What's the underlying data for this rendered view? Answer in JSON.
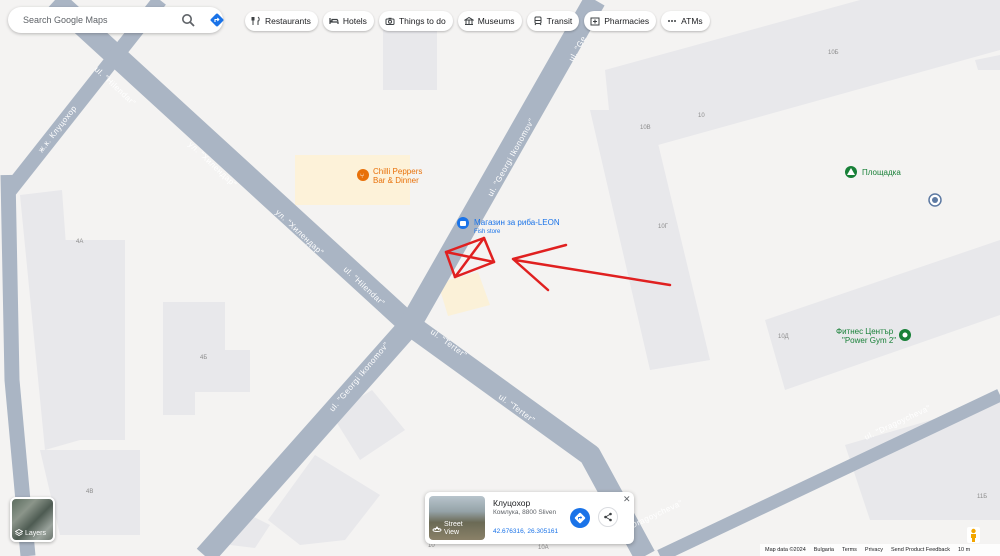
{
  "search": {
    "placeholder": "Search Google Maps"
  },
  "chips": [
    {
      "label": "Restaurants",
      "icon": "fork-knife-icon"
    },
    {
      "label": "Hotels",
      "icon": "bed-icon"
    },
    {
      "label": "Things to do",
      "icon": "camera-icon"
    },
    {
      "label": "Museums",
      "icon": "museum-icon"
    },
    {
      "label": "Transit",
      "icon": "train-icon"
    },
    {
      "label": "Pharmacies",
      "icon": "pharmacy-icon"
    },
    {
      "label": "ATMs",
      "icon": "atm-icon"
    }
  ],
  "map": {
    "streets": {
      "hilendar_cyr": "ул. \"Хилендар\"",
      "hilendar_cyr2": "ул. \"Хилендар\"",
      "hilendar_lat": "ul. \"Hilendar\"",
      "hilendar_lat2": "ul. \"Hilendar\"",
      "klyuchohor": "ж.к. Клуцохор",
      "ikonomov_top": "ul. \"Georgi Ikonomov\"",
      "ikonomov_bottom": "ul. \"Georgi Ikonomov\"",
      "terter_1": "ul. \"Terter\"",
      "terter_2": "ul. \"Terter\"",
      "dragoycheva_1": "ul. \"Dragoycheva\"",
      "dragoycheva_2": "ul. \"Dragoycheva\"",
      "top_fragment": "ul. \"Ge"
    },
    "building_numbers": [
      "10Б",
      "10В",
      "10",
      "10Г",
      "4А",
      "4Б",
      "4В",
      "10Д",
      "11Б",
      "10",
      "10А"
    ],
    "places": {
      "chilli": {
        "line1": "Chilli Peppers",
        "line2": "Bar & Dinner"
      },
      "fish": {
        "name": "Магазин за риба-LEON",
        "type": "Fish store"
      },
      "ploshtadka": "Площадка",
      "fitness": {
        "line1": "Фитнес Център",
        "line2": "\"Power Gym 2\""
      }
    },
    "colors": {
      "background": "#f4f3f2",
      "road": "#aab5c4",
      "building": "#e8e8eb",
      "restaurant_lot": "#fdf2d9",
      "annotation": "#e02020",
      "poi_orange": "#e8710a",
      "poi_blue": "#1a73e8",
      "poi_green": "#188038"
    }
  },
  "layers": {
    "label": "Layers"
  },
  "card": {
    "title": "Клуцохор",
    "address": "Комлука, 8800 Sliven",
    "coords": "42.676316, 26.305161",
    "street_view": "Street View"
  },
  "attribution": [
    "Map data ©2024",
    "Bulgaria",
    "Terms",
    "Privacy",
    "Send Product Feedback",
    "10 m"
  ]
}
